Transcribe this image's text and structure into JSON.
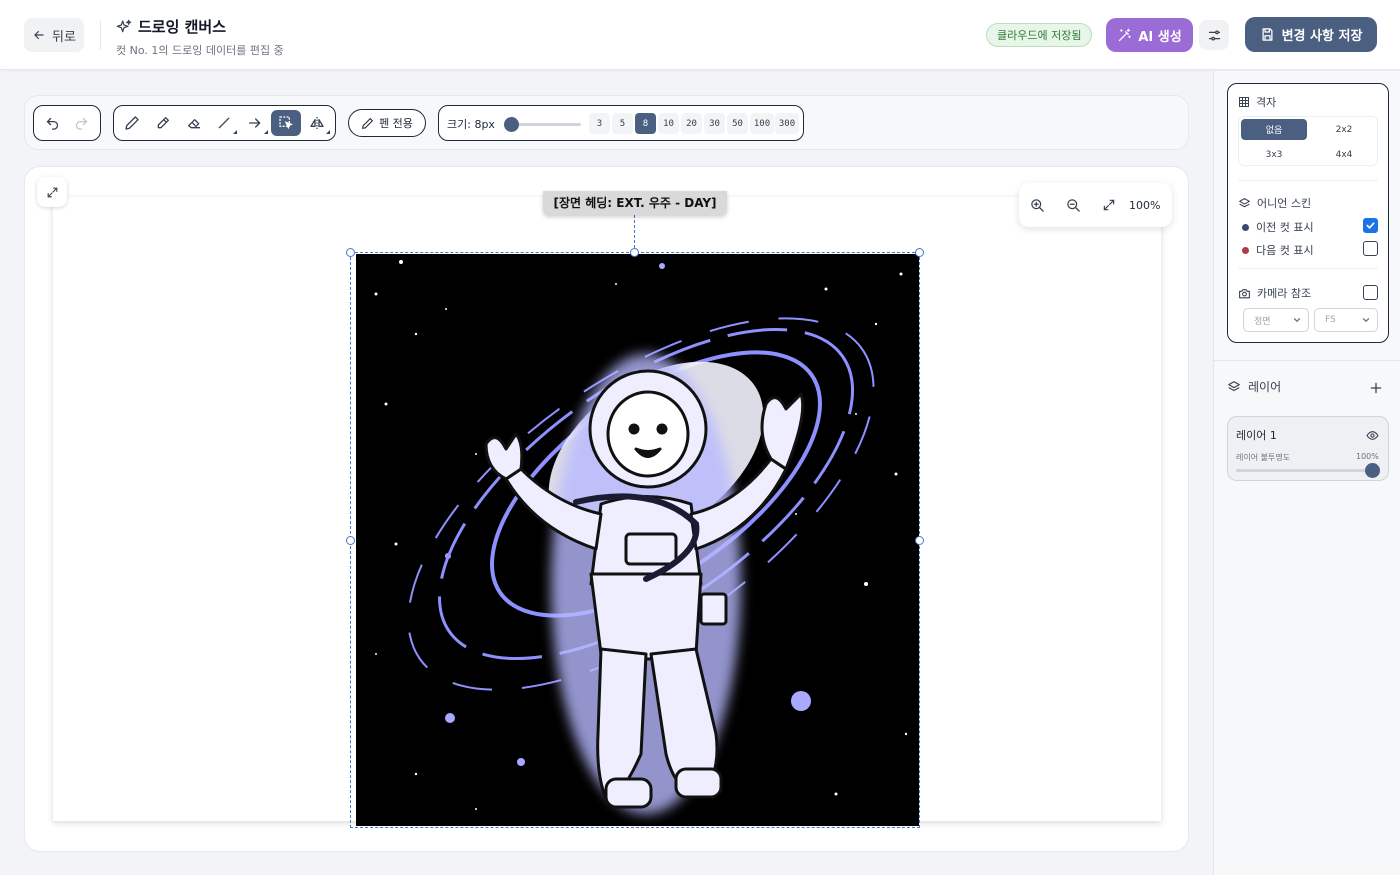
{
  "header": {
    "back_label": "뒤로",
    "title": "드로잉 캔버스",
    "subtitle": "컷 No. 1의 드로잉 데이터를 편집 중",
    "saved_badge": "클라우드에 저장됨",
    "ai_label": "AI 생성",
    "save_label": "변경 사항 저장"
  },
  "toolbar": {
    "pen_only_label": "펜 전용",
    "size_label": "크기: 8px",
    "size_value": 8,
    "size_presets": [
      "3",
      "5",
      "8",
      "10",
      "20",
      "30",
      "50",
      "100",
      "300"
    ],
    "active_preset": "8",
    "active_tool": "lasso-select"
  },
  "canvas": {
    "scene_tag": "[장면 헤딩: EXT. 우주 - DAY]",
    "zoom_label": "100%"
  },
  "sidebar": {
    "grid": {
      "title": "격자",
      "options": [
        "없음",
        "2x2",
        "3x3",
        "4x4"
      ],
      "selected": "없음"
    },
    "onion": {
      "title": "어니언 스킨",
      "prev_label": "이전 컷 표시",
      "prev_checked": true,
      "prev_color": "#3b4a6b",
      "next_label": "다음 컷 표시",
      "next_checked": false,
      "next_color": "#b23a48"
    },
    "camera": {
      "title": "카메라 참조",
      "checked": false,
      "angle_value": "정면",
      "shot_value": "FS"
    },
    "layers": {
      "title": "레이어",
      "items": [
        {
          "name": "레이어 1",
          "opacity_label": "레이어 불투명도",
          "opacity_value": "100%",
          "opacity": 1.0
        }
      ]
    }
  },
  "colors": {
    "accent": "#4b5f80",
    "ai": "#9b6bd6",
    "saved_bg": "#e8f5e9",
    "glow": "#8f90ff"
  }
}
